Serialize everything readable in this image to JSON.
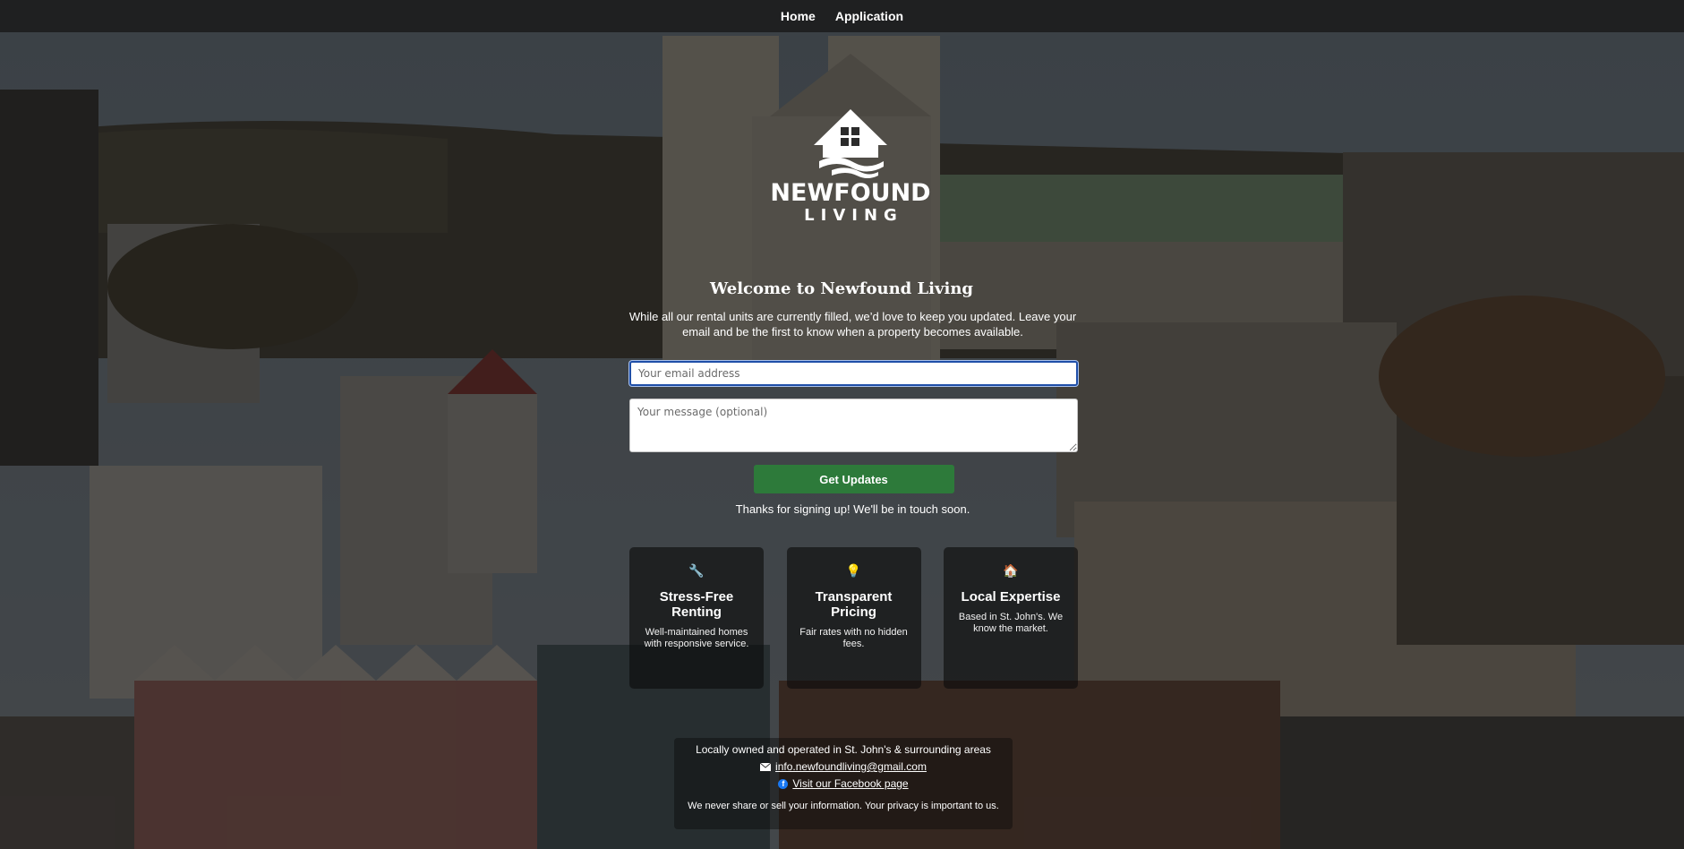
{
  "nav": {
    "links": [
      {
        "label": "Home"
      },
      {
        "label": "Application"
      }
    ]
  },
  "logo": {
    "brand": "NEWFOUND",
    "sub": "LIVING",
    "icon": "house-waves-icon"
  },
  "hero": {
    "title": "Welcome to Newfound Living",
    "intro": "While all our rental units are currently filled, we’d love to keep you updated. Leave your email and be the first to know when a property becomes available."
  },
  "form": {
    "email_placeholder": "Your email address",
    "message_placeholder": "Your message (optional)",
    "submit_label": "Get Updates",
    "thanks": "Thanks for signing up! We'll be in touch soon."
  },
  "features": [
    {
      "icon": "wrench-icon",
      "glyph": "🔧",
      "title": "Stress-Free Renting",
      "text": "Well-maintained homes with responsive service."
    },
    {
      "icon": "lightbulb-icon",
      "glyph": "💡",
      "title": "Transparent Pricing",
      "text": "Fair rates with no hidden fees."
    },
    {
      "icon": "house-icon",
      "glyph": "🏠",
      "title": "Local Expertise",
      "text": "Based in St. John's. We know the market."
    }
  ],
  "footer": {
    "location": "Locally owned and operated in St. John's & surrounding areas",
    "email": "info.newfoundliving@gmail.com",
    "facebook": "Visit our Facebook page",
    "privacy": "We never share or sell your information. Your privacy is important to us."
  },
  "colors": {
    "nav_bg": "#1f2021",
    "accent_green": "#2d7a3a",
    "focus_blue": "#1f4fa8",
    "facebook_blue": "#1877f2"
  }
}
